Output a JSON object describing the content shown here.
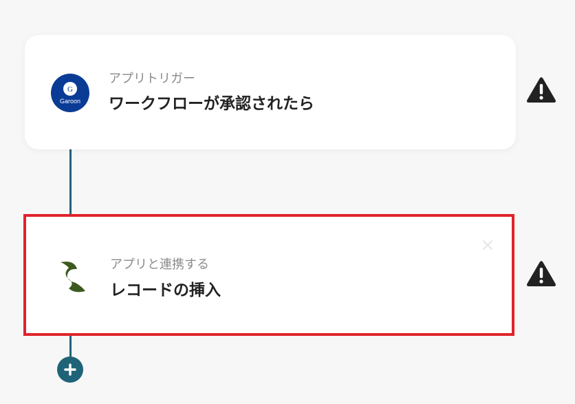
{
  "steps": [
    {
      "app": "Garoon",
      "app_logo_letter": "G",
      "app_icon": "garoon-logo-icon",
      "subtitle": "アプリトリガー",
      "title": "ワークフローが承認されたら",
      "warning_icon": "warning-icon"
    },
    {
      "app_icon": "app-logo-icon",
      "subtitle": "アプリと連携する",
      "title": "レコードの挿入",
      "selected": true,
      "close_icon": "close-icon",
      "warning_icon": "warning-icon"
    }
  ],
  "add_step_icon": "plus-icon",
  "colors": {
    "connector": "#1f6378",
    "selection_border": "#e0232b",
    "garoon_blue": "#0a3c96",
    "warning": "#222222",
    "app_logo_green": "#3d5a1e"
  }
}
